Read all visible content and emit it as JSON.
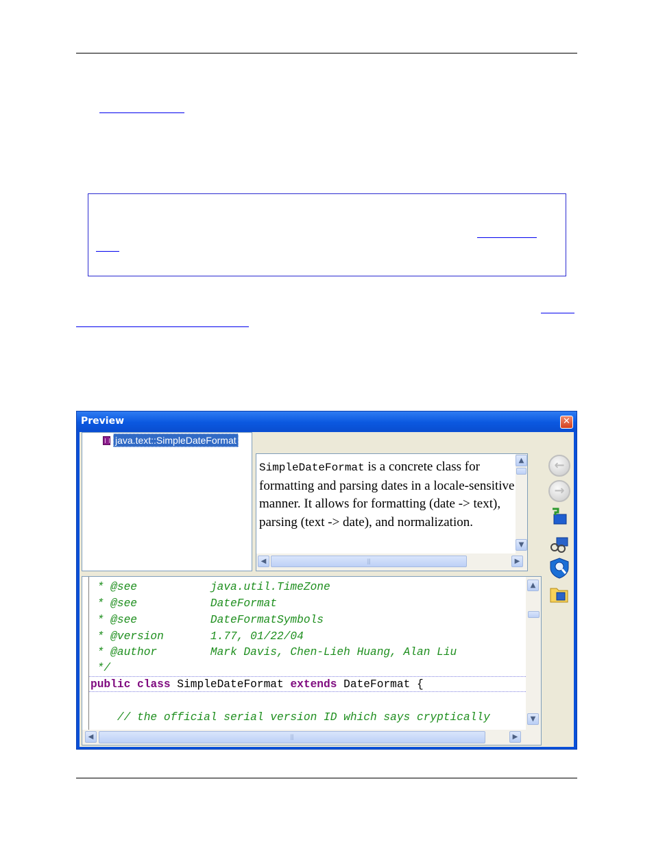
{
  "window": {
    "title": "Preview",
    "close_glyph": "✕"
  },
  "tree": {
    "item_label": "java.text::SimpleDateFormat",
    "item_icon": "class-icon"
  },
  "doc": {
    "class_name": "SimpleDateFormat",
    "text": " is a concrete class for formatting and parsing dates in a locale-sensitive manner. It allows for formatting (date -> text), parsing (text -> date), and normalization."
  },
  "toolbar": {
    "back_icon": "back-arrow-icon",
    "forward_icon": "forward-arrow-icon",
    "tools": [
      "go-to-source-icon",
      "find-references-icon",
      "search-shield-icon",
      "open-folder-icon"
    ]
  },
  "scroll": {
    "up": "▲",
    "down": "▼",
    "left": "◀",
    "right": "▶",
    "grip": "|||"
  },
  "code": {
    "lines": [
      {
        "parts": [
          {
            "c": "cm",
            "t": " * @see           java.util.TimeZone"
          }
        ]
      },
      {
        "parts": [
          {
            "c": "cm",
            "t": " * @see           DateFormat"
          }
        ]
      },
      {
        "parts": [
          {
            "c": "cm",
            "t": " * @see           DateFormatSymbols"
          }
        ]
      },
      {
        "parts": [
          {
            "c": "cm",
            "t": " * @version       1.77, 01/22/04"
          }
        ]
      },
      {
        "parts": [
          {
            "c": "cm",
            "t": " * @author        Mark Davis, Chen-Lieh Huang, Alan Liu"
          }
        ]
      },
      {
        "parts": [
          {
            "c": "cm",
            "t": " */"
          }
        ]
      },
      {
        "parts": [
          {
            "c": "kw",
            "t": "public"
          },
          {
            "c": "pl",
            "t": " "
          },
          {
            "c": "kw",
            "t": "class"
          },
          {
            "c": "pl",
            "t": " SimpleDateFormat "
          },
          {
            "c": "kw",
            "t": "extends"
          },
          {
            "c": "pl",
            "t": " DateFormat {"
          }
        ]
      },
      {
        "parts": [
          {
            "c": "pl",
            "t": ""
          }
        ]
      },
      {
        "parts": [
          {
            "c": "cm",
            "t": "    // the official serial version ID which says cryptically"
          }
        ]
      }
    ]
  }
}
